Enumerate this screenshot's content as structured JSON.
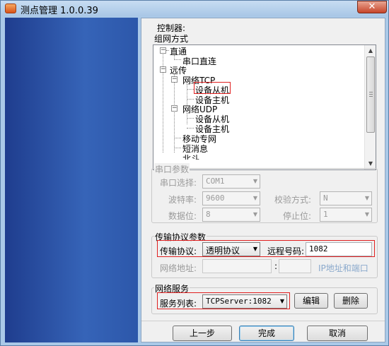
{
  "window": {
    "title": "测点管理 1.0.0.39",
    "close_label": "✕"
  },
  "controller": {
    "label": "控制器:"
  },
  "network_mode": {
    "label": "组网方式",
    "tree": {
      "direct": "直通",
      "serial_direct": "串口直连",
      "remote": "远传",
      "tcp": "网络TCP",
      "tcp_slave": "设备从机",
      "tcp_master": "设备主机",
      "udp": "网络UDP",
      "udp_slave": "设备从机",
      "udp_master": "设备主机",
      "mobile": "移动专网",
      "sms": "短消息",
      "beidou": "北斗"
    }
  },
  "serial": {
    "label": "串口参数",
    "port_label": "串口选择:",
    "port_value": "COM1",
    "baud_label": "波特率:",
    "baud_value": "9600",
    "check_label": "校验方式:",
    "check_value": "N",
    "databits_label": "数据位:",
    "databits_value": "8",
    "stopbits_label": "停止位:",
    "stopbits_value": "1"
  },
  "transport": {
    "label": "传输协议参数",
    "protocol_label": "传输协议:",
    "protocol_value": "透明协议",
    "remote_id_label": "远程号码:",
    "remote_id_value": "1082",
    "address_label": "网络地址:",
    "colon": ":",
    "ip_link": "IP地址和端口"
  },
  "service": {
    "label": "网络服务",
    "list_label": "服务列表:",
    "list_value": "TCPServer:1082",
    "edit_label": "编辑",
    "delete_label": "删除"
  },
  "footer": {
    "prev_label": "上一步",
    "finish_label": "完成",
    "cancel_label": "取消"
  }
}
